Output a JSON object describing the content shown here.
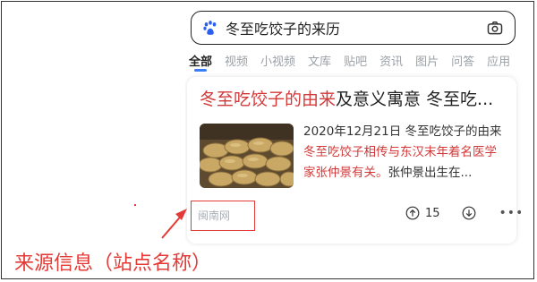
{
  "search": {
    "query": "冬至吃饺子的来历"
  },
  "tabs": [
    "全部",
    "视频",
    "小视频",
    "文库",
    "贴吧",
    "资讯",
    "图片",
    "问答",
    "应用"
  ],
  "result": {
    "title_highlight": "冬至吃饺子的由来",
    "title_rest": "及意义寓意 冬至吃...",
    "snippet_date": "2020年12月21日",
    "snippet_lead": "冬至吃饺子的由来",
    "snippet_highlight": "冬至吃饺子相传与东汉末年着名医学家张仲景有关。",
    "snippet_tail": "张仲景出生在...",
    "source": "闽南网",
    "like_count": "15"
  },
  "annotation": {
    "label": "来源信息（站点名称）"
  },
  "colors": {
    "highlight": "#d23a3a",
    "tab_active_underline": "#3b7cf7",
    "annotation": "#e53935"
  },
  "icons": {
    "search_logo": "baidu-paw-icon",
    "camera": "camera-icon",
    "like": "thumb-up-arrow-icon",
    "dislike": "thumb-down-arrow-icon",
    "more": "more-dots-icon"
  }
}
